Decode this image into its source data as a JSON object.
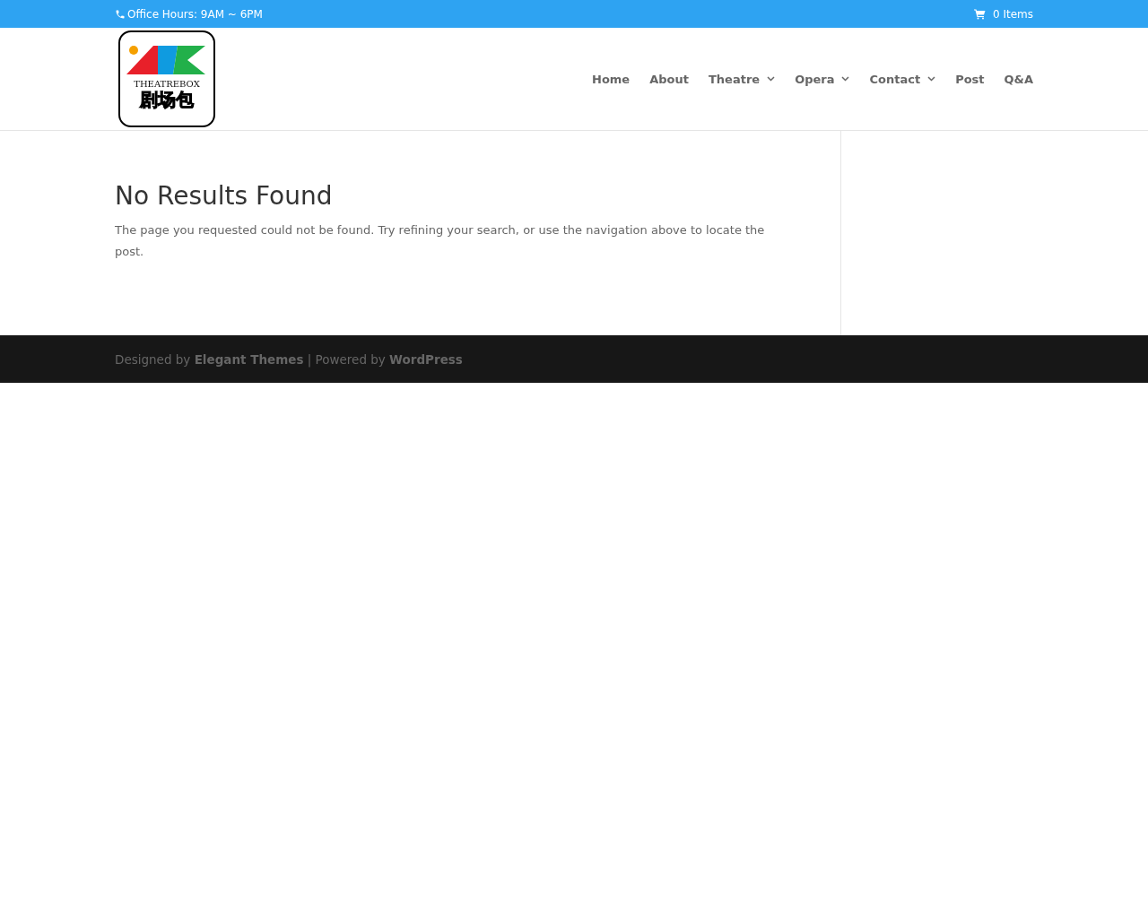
{
  "top_bar": {
    "office_hours": "Office Hours: 9AM ~ 6PM",
    "cart": "0 Items"
  },
  "logo": {
    "name": "THEATREBOX",
    "chinese_name": "剧场包"
  },
  "nav": [
    {
      "label": "Home",
      "has_dropdown": false
    },
    {
      "label": "About",
      "has_dropdown": false
    },
    {
      "label": "Theatre",
      "has_dropdown": true
    },
    {
      "label": "Opera",
      "has_dropdown": true
    },
    {
      "label": "Contact",
      "has_dropdown": true
    },
    {
      "label": "Post",
      "has_dropdown": false
    },
    {
      "label": "Q&A",
      "has_dropdown": false
    }
  ],
  "content": {
    "title": "No Results Found",
    "message": "The page you requested could not be found. Try refining your search, or use the navigation above to locate the post."
  },
  "footer": {
    "credits": "Designed by **Elegant Themes** | Powered by **WordPress**"
  }
}
